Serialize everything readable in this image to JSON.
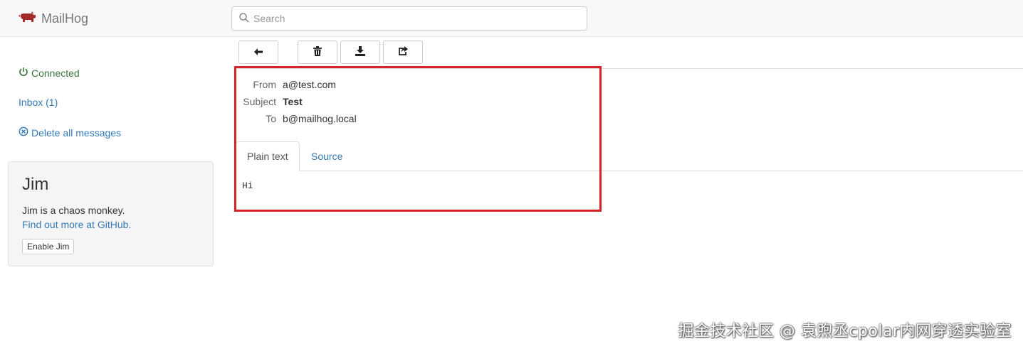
{
  "app": {
    "name": "MailHog"
  },
  "search": {
    "placeholder": "Search"
  },
  "sidebar": {
    "status": "Connected",
    "inbox": "Inbox (1)",
    "delete_all": "Delete all messages"
  },
  "jim": {
    "title": "Jim",
    "description": "Jim is a chaos monkey.",
    "link": "Find out more at GitHub.",
    "button": "Enable Jim"
  },
  "toolbar": {
    "icons": [
      "arrow-left-icon",
      "trash-icon",
      "download-icon",
      "share-icon"
    ]
  },
  "message": {
    "headers": [
      {
        "label": "From",
        "value": "a@test.com",
        "bold": false
      },
      {
        "label": "Subject",
        "value": "Test",
        "bold": true
      },
      {
        "label": "To",
        "value": "b@mailhog.local",
        "bold": false
      }
    ],
    "tabs": [
      {
        "label": "Plain text",
        "active": true
      },
      {
        "label": "Source",
        "active": false
      }
    ],
    "body": "Hi"
  },
  "watermark": "掘金技术社区 @ 袁煦丞cpolar内网穿透实验室",
  "colors": {
    "brand_icon": "#a52a2a",
    "link": "#337ab7",
    "connected": "#3c763d",
    "highlight": "#d9232a"
  }
}
